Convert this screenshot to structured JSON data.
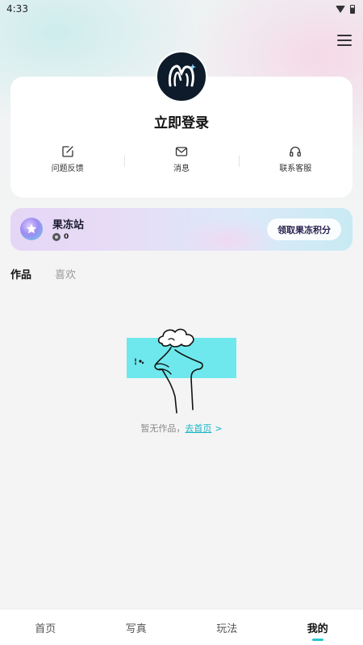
{
  "status_bar": {
    "time": "4:33"
  },
  "header": {
    "menu_icon": "hamburger-icon"
  },
  "profile": {
    "login_label": "立即登录",
    "avatar_icon": "app-logo-icon",
    "actions": [
      {
        "label": "问题反馈",
        "icon": "feedback-edit-icon"
      },
      {
        "label": "消息",
        "icon": "mail-icon"
      },
      {
        "label": "联系客服",
        "icon": "headset-icon"
      }
    ]
  },
  "jelly": {
    "title": "果冻站",
    "points": "0",
    "claim_label": "领取果冻积分",
    "logo_icon": "star-icon",
    "coin_icon": "coin-icon"
  },
  "content_tabs": [
    {
      "label": "作品",
      "active": true
    },
    {
      "label": "喜欢",
      "active": false
    }
  ],
  "empty_state": {
    "text": "暂无作品，",
    "link": "去首页",
    "chevron": ">"
  },
  "bottom_nav": [
    {
      "label": "首页",
      "active": false
    },
    {
      "label": "写真",
      "active": false
    },
    {
      "label": "玩法",
      "active": false
    },
    {
      "label": "我的",
      "active": true
    }
  ],
  "colors": {
    "accent": "#25c7d0",
    "link": "#19b6c4",
    "illustration": "#6ee8ec",
    "avatar_bg": "#0d1b2a"
  }
}
